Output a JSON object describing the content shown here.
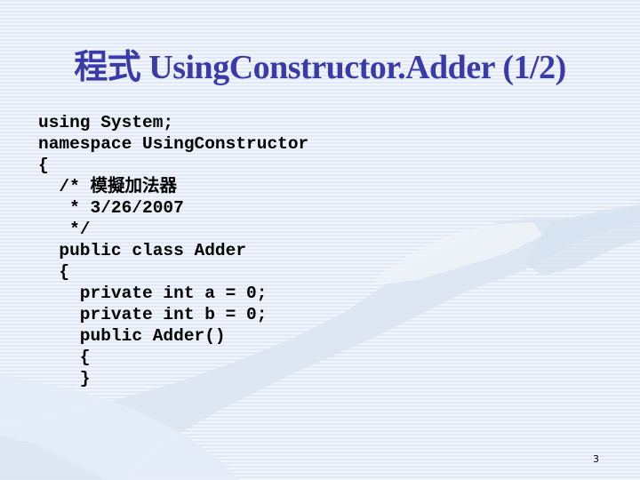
{
  "slide": {
    "title": "程式 UsingConstructor.Adder (1/2)",
    "code_lines": [
      "using System;",
      "namespace UsingConstructor",
      "{",
      "  /* 模擬加法器",
      "   * 3/26/2007",
      "   */",
      "  public class Adder",
      "  {",
      "    private int a = 0;",
      "    private int b = 0;",
      "    public Adder()",
      "    {",
      "    }"
    ],
    "page_number": "3"
  },
  "colors": {
    "title": "#3a3aa8",
    "background": "#eaf0fa",
    "stripe": "#e1e9f6",
    "watermark": "#dde7f3"
  }
}
